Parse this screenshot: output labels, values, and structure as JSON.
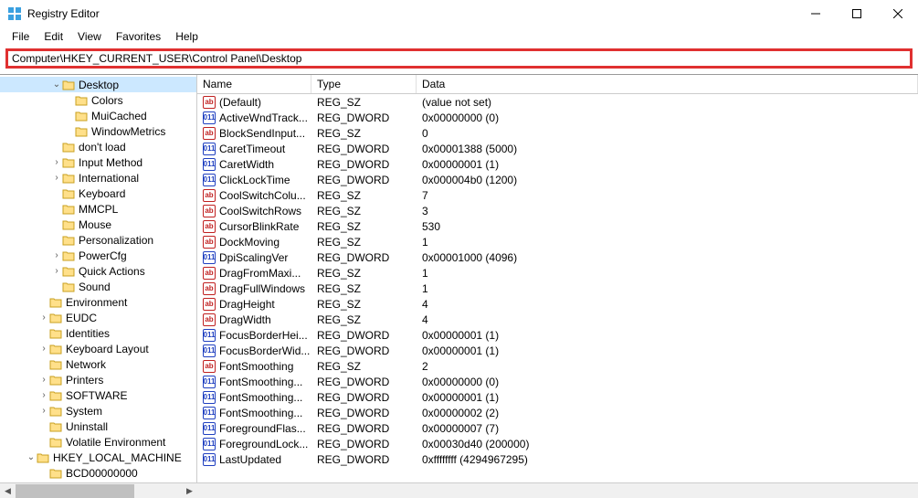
{
  "window": {
    "title": "Registry Editor"
  },
  "menu": {
    "file": "File",
    "edit": "Edit",
    "view": "View",
    "favorites": "Favorites",
    "help": "Help"
  },
  "addressbar": {
    "path": "Computer\\HKEY_CURRENT_USER\\Control Panel\\Desktop"
  },
  "list": {
    "headers": {
      "name": "Name",
      "type": "Type",
      "data": "Data"
    },
    "rows": [
      {
        "icon": "sz",
        "name": "(Default)",
        "type": "REG_SZ",
        "data": "(value not set)"
      },
      {
        "icon": "bin",
        "name": "ActiveWndTrack...",
        "type": "REG_DWORD",
        "data": "0x00000000 (0)"
      },
      {
        "icon": "sz",
        "name": "BlockSendInput...",
        "type": "REG_SZ",
        "data": "0"
      },
      {
        "icon": "bin",
        "name": "CaretTimeout",
        "type": "REG_DWORD",
        "data": "0x00001388 (5000)"
      },
      {
        "icon": "bin",
        "name": "CaretWidth",
        "type": "REG_DWORD",
        "data": "0x00000001 (1)"
      },
      {
        "icon": "bin",
        "name": "ClickLockTime",
        "type": "REG_DWORD",
        "data": "0x000004b0 (1200)"
      },
      {
        "icon": "sz",
        "name": "CoolSwitchColu...",
        "type": "REG_SZ",
        "data": "7"
      },
      {
        "icon": "sz",
        "name": "CoolSwitchRows",
        "type": "REG_SZ",
        "data": "3"
      },
      {
        "icon": "sz",
        "name": "CursorBlinkRate",
        "type": "REG_SZ",
        "data": "530"
      },
      {
        "icon": "sz",
        "name": "DockMoving",
        "type": "REG_SZ",
        "data": "1"
      },
      {
        "icon": "bin",
        "name": "DpiScalingVer",
        "type": "REG_DWORD",
        "data": "0x00001000 (4096)"
      },
      {
        "icon": "sz",
        "name": "DragFromMaxi...",
        "type": "REG_SZ",
        "data": "1"
      },
      {
        "icon": "sz",
        "name": "DragFullWindows",
        "type": "REG_SZ",
        "data": "1"
      },
      {
        "icon": "sz",
        "name": "DragHeight",
        "type": "REG_SZ",
        "data": "4"
      },
      {
        "icon": "sz",
        "name": "DragWidth",
        "type": "REG_SZ",
        "data": "4"
      },
      {
        "icon": "bin",
        "name": "FocusBorderHei...",
        "type": "REG_DWORD",
        "data": "0x00000001 (1)"
      },
      {
        "icon": "bin",
        "name": "FocusBorderWid...",
        "type": "REG_DWORD",
        "data": "0x00000001 (1)"
      },
      {
        "icon": "sz",
        "name": "FontSmoothing",
        "type": "REG_SZ",
        "data": "2"
      },
      {
        "icon": "bin",
        "name": "FontSmoothing...",
        "type": "REG_DWORD",
        "data": "0x00000000 (0)"
      },
      {
        "icon": "bin",
        "name": "FontSmoothing...",
        "type": "REG_DWORD",
        "data": "0x00000001 (1)"
      },
      {
        "icon": "bin",
        "name": "FontSmoothing...",
        "type": "REG_DWORD",
        "data": "0x00000002 (2)"
      },
      {
        "icon": "bin",
        "name": "ForegroundFlas...",
        "type": "REG_DWORD",
        "data": "0x00000007 (7)"
      },
      {
        "icon": "bin",
        "name": "ForegroundLock...",
        "type": "REG_DWORD",
        "data": "0x00030d40 (200000)"
      },
      {
        "icon": "bin",
        "name": "LastUpdated",
        "type": "REG_DWORD",
        "data": "0xffffffff (4294967295)"
      }
    ]
  },
  "tree": {
    "items": [
      {
        "indent": 4,
        "twisty": "v",
        "label": "Desktop",
        "selected": true
      },
      {
        "indent": 5,
        "twisty": "",
        "label": "Colors"
      },
      {
        "indent": 5,
        "twisty": "",
        "label": "MuiCached"
      },
      {
        "indent": 5,
        "twisty": "",
        "label": "WindowMetrics"
      },
      {
        "indent": 4,
        "twisty": "",
        "label": "don't load"
      },
      {
        "indent": 4,
        "twisty": ">",
        "label": "Input Method"
      },
      {
        "indent": 4,
        "twisty": ">",
        "label": "International"
      },
      {
        "indent": 4,
        "twisty": "",
        "label": "Keyboard"
      },
      {
        "indent": 4,
        "twisty": "",
        "label": "MMCPL"
      },
      {
        "indent": 4,
        "twisty": "",
        "label": "Mouse"
      },
      {
        "indent": 4,
        "twisty": "",
        "label": "Personalization"
      },
      {
        "indent": 4,
        "twisty": ">",
        "label": "PowerCfg"
      },
      {
        "indent": 4,
        "twisty": ">",
        "label": "Quick Actions"
      },
      {
        "indent": 4,
        "twisty": "",
        "label": "Sound"
      },
      {
        "indent": 3,
        "twisty": "",
        "label": "Environment"
      },
      {
        "indent": 3,
        "twisty": ">",
        "label": "EUDC"
      },
      {
        "indent": 3,
        "twisty": "",
        "label": "Identities"
      },
      {
        "indent": 3,
        "twisty": ">",
        "label": "Keyboard Layout"
      },
      {
        "indent": 3,
        "twisty": "",
        "label": "Network"
      },
      {
        "indent": 3,
        "twisty": ">",
        "label": "Printers"
      },
      {
        "indent": 3,
        "twisty": ">",
        "label": "SOFTWARE"
      },
      {
        "indent": 3,
        "twisty": ">",
        "label": "System"
      },
      {
        "indent": 3,
        "twisty": "",
        "label": "Uninstall"
      },
      {
        "indent": 3,
        "twisty": "",
        "label": "Volatile Environment"
      },
      {
        "indent": 2,
        "twisty": "v",
        "label": "HKEY_LOCAL_MACHINE"
      },
      {
        "indent": 3,
        "twisty": "",
        "label": "BCD00000000"
      }
    ]
  }
}
